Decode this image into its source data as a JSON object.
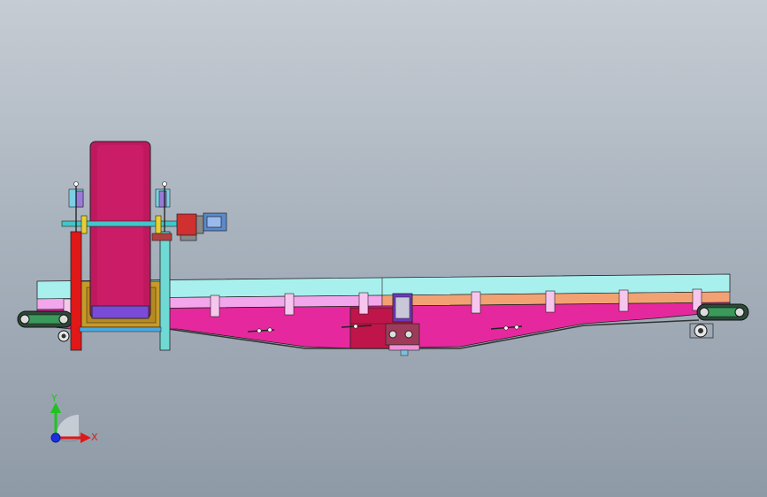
{
  "viewport": {
    "background_top": "#c6ccd3",
    "background_bottom": "#8f9aa7"
  },
  "triad": {
    "y_label": "Y",
    "x_label": "X",
    "y_color": "#1fc31f",
    "x_color": "#e01818",
    "z_color": "#1b2fe0"
  },
  "colors": {
    "frame_cyan": "#a8f0ee",
    "frame_pink": "#f0a0e8",
    "frame_orange": "#f0a070",
    "body_magenta": "#e6289e",
    "drum_crimson": "#c0185e",
    "support_red": "#e01818",
    "support_cyan": "#6fd9d4",
    "base_mustard": "#c89a28",
    "motor_purple": "#7a4ad8",
    "track_green": "#3a9a5a"
  }
}
